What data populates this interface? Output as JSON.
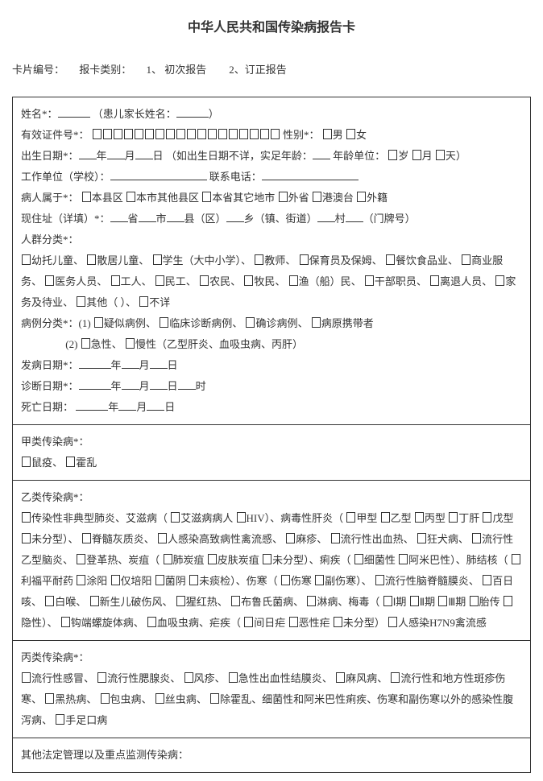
{
  "title": "中华人民共和国传染病报告卡",
  "header": {
    "cardNo": "卡片编号：",
    "reportType": "报卡类别：",
    "opt1": "1、 初次报告",
    "opt2": "2、订正报告"
  },
  "s1": {
    "name": "姓名*：",
    "childParent": "（患儿家长姓名：",
    "paren": "）",
    "idLabel": "有效证件号*：",
    "sexLabel": "性别*：",
    "male": "男",
    "female": "女",
    "birthLabel": "出生日期*：",
    "y": "年",
    "m": "月",
    "d": "日",
    "birthNote": "（如出生日期不详，实足年龄：",
    "ageUnitLabel": "年龄单位：",
    "ageY": "岁",
    "ageM": "月",
    "ageD": "天）",
    "workUnit": "工作单位（学校）：",
    "phone": "联系电话：",
    "belongLabel": "病人属于*：",
    "b1": "本县区",
    "b2": "本市其他县区",
    "b3": "本省其它地市",
    "b4": "外省",
    "b5": "港澳台",
    "b6": "外籍",
    "addrLabel": "现住址（详填）*：",
    "prov": "省",
    "city": "市",
    "county": "县（区）",
    "town": "乡（镇、街道）",
    "village": "村",
    "doorNo": "（门牌号）",
    "groupLabel": "人群分类*：",
    "g1": "幼托儿童、",
    "g2": "散居儿童、",
    "g3": "学生（大中小学）、",
    "g4": "教师、",
    "g5": "保育员及保姆、",
    "g6": "餐饮食品业、",
    "g7": "商业服务、",
    "g8": "医务人员、",
    "g9": "工人、",
    "g10": "民工、",
    "g11": "农民、",
    "g12": "牧民、",
    "g13": "渔（船）民、",
    "g14": "干部职员、",
    "g15": "离退人员、",
    "g16": "家务及待业、",
    "g17": "其他（   ）、",
    "g18": "不详",
    "caseLabel": "病例分类*：(1)",
    "c1": "疑似病例、",
    "c2": "临床诊断病例、",
    "c3": "确诊病例、",
    "c4": "病原携带者",
    "case2Prefix": "(2)",
    "c5": "急性、",
    "c6": "慢性（乙型肝炎、血吸虫病、丙肝）",
    "onsetLabel": "发病日期*：",
    "diagLabel": "诊断日期*：",
    "hour": "时",
    "deathLabel": "死亡日期：  "
  },
  "s2": {
    "label": "甲类传染病*：",
    "d1": "鼠疫、",
    "d2": "霍乱"
  },
  "s3": {
    "label": "乙类传染病*：",
    "d1": "传染性非典型肺炎、艾滋病（",
    "d1a": "艾滋病病人",
    "d1b": "HIV）、病毒性肝炎（",
    "h1": "甲型",
    "h2": "乙型",
    "h3": "丙型",
    "h4": "丁肝",
    "h5": "戊型",
    "h6": "未分型）、",
    "d2": "脊髓灰质炎、",
    "d3": "人感染高致病性禽流感、",
    "d4": "麻疹、",
    "d5": "流行性出血热、",
    "d6": "狂犬病、",
    "d7": "流行性乙型脑炎、",
    "d8": "登革热、炭疽（",
    "a1": "肺炭疽",
    "a2": "皮肤炭疽",
    "a3": "未分型）、痢疾（",
    "dy1": "细菌性",
    "dy2": "阿米巴性）、肺结核（",
    "t1": "利福平耐药",
    "t2": "涂阳",
    "t3": "仅培阳",
    "t4": "菌阴",
    "t5": "未痰检）、伤寒（",
    "ty1": "伤寒",
    "ty2": "副伤寒）、",
    "d9": "流行性脑脊髓膜炎、",
    "d10": "百日咳、",
    "d11": "白喉、",
    "d12": "新生儿破伤风、",
    "d13": "猩红热、",
    "d14": "布鲁氏菌病、",
    "d15": "淋病、梅毒（",
    "m1": "Ⅰ期",
    "m2": "Ⅱ期",
    "m3": "Ⅲ期",
    "m4": "胎传",
    "m5": "隐性）、",
    "d16": "钩端螺旋体病、",
    "d17": "血吸虫病、疟疾（",
    "ml1": "间日疟",
    "ml2": "恶性疟",
    "ml3": "未分型）",
    "d18": "人感染H7N9禽流感"
  },
  "s4": {
    "label": "丙类传染病*：",
    "d1": "流行性感冒、",
    "d2": "流行性腮腺炎、",
    "d3": "风疹、",
    "d4": "急性出血性结膜炎、",
    "d5": "麻风病、",
    "d6": "流行性和地方性斑疹伤寒、",
    "d7": "黑热病、",
    "d8": "包虫病、",
    "d9": "丝虫病、",
    "d10": "除霍乱、细菌性和阿米巴性痢疾、伤寒和副伤寒以外的感染性腹泻病、",
    "d11": "手足口病"
  },
  "s5": {
    "label": "其他法定管理以及重点监测传染病："
  }
}
